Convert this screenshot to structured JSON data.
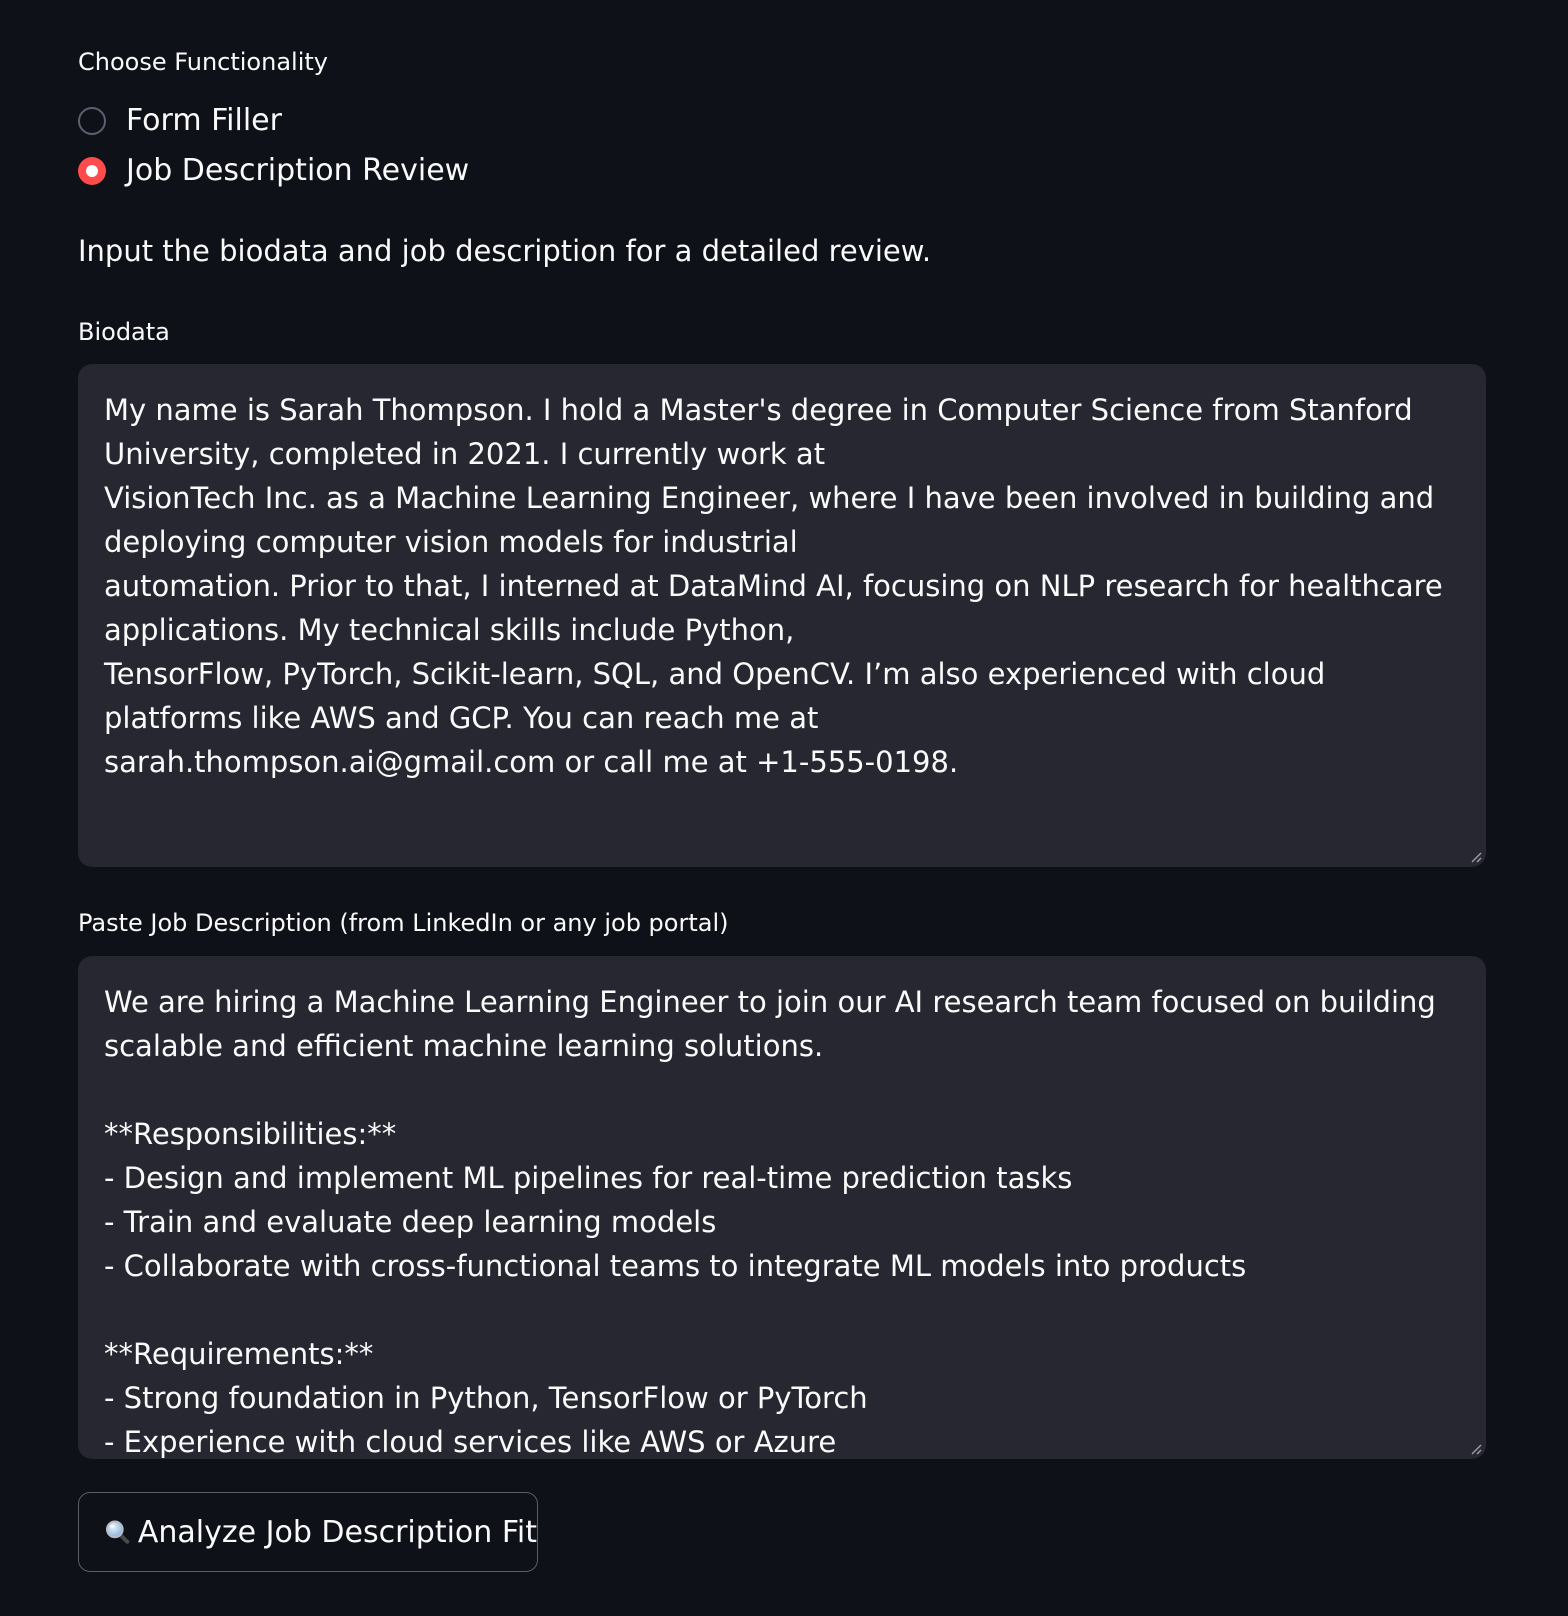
{
  "functionality": {
    "label": "Choose Functionality",
    "options": [
      {
        "label": "Form Filler",
        "selected": false
      },
      {
        "label": "Job Description Review",
        "selected": true
      }
    ],
    "accent_color": "#ff4b4b"
  },
  "intro_text": "Input the biodata and job description for a detailed review.",
  "biodata": {
    "label": "Biodata",
    "value": "My name is Sarah Thompson. I hold a Master's degree in Computer Science from Stanford University, completed in 2021. I currently work at\nVisionTech Inc. as a Machine Learning Engineer, where I have been involved in building and deploying computer vision models for industrial\nautomation. Prior to that, I interned at DataMind AI, focusing on NLP research for healthcare applications. My technical skills include Python,\nTensorFlow, PyTorch, Scikit-learn, SQL, and OpenCV. I’m also experienced with cloud platforms like AWS and GCP. You can reach me at\nsarah.thompson.ai@gmail.com or call me at +1-555-0198."
  },
  "job_description": {
    "label": "Paste Job Description (from LinkedIn or any job portal)",
    "value": "We are hiring a Machine Learning Engineer to join our AI research team focused on building scalable and efficient machine learning solutions.\n\n**Responsibilities:**\n- Design and implement ML pipelines for real-time prediction tasks\n- Train and evaluate deep learning models\n- Collaborate with cross-functional teams to integrate ML models into products\n\n**Requirements:**\n- Strong foundation in Python, TensorFlow or PyTorch\n- Experience with cloud services like AWS or Azure"
  },
  "analyze_button": {
    "icon": "magnifying-glass-icon",
    "label": "Analyze Job Description Fit"
  }
}
